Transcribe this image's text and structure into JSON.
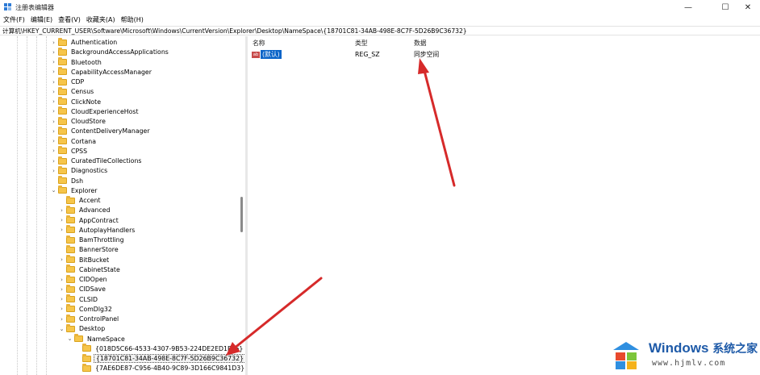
{
  "window": {
    "title": "注册表编辑器",
    "controls": {
      "minimize": "—",
      "maximize": "☐",
      "close": "✕"
    }
  },
  "menu": [
    "文件(F)",
    "编辑(E)",
    "查看(V)",
    "收藏夹(A)",
    "帮助(H)"
  ],
  "address": "计算机\\HKEY_CURRENT_USER\\Software\\Microsoft\\Windows\\CurrentVersion\\Explorer\\Desktop\\NameSpace\\{18701C81-34AB-498E-8C7F-5D26B9C36732}",
  "tree": {
    "level1": [
      {
        "label": "Authentication",
        "expander": "collapsed"
      },
      {
        "label": "BackgroundAccessApplications",
        "expander": "collapsed"
      },
      {
        "label": "Bluetooth",
        "expander": "collapsed"
      },
      {
        "label": "CapabilityAccessManager",
        "expander": "collapsed"
      },
      {
        "label": "CDP",
        "expander": "collapsed"
      },
      {
        "label": "Census",
        "expander": "collapsed"
      },
      {
        "label": "ClickNote",
        "expander": "collapsed"
      },
      {
        "label": "CloudExperienceHost",
        "expander": "collapsed"
      },
      {
        "label": "CloudStore",
        "expander": "collapsed"
      },
      {
        "label": "ContentDeliveryManager",
        "expander": "collapsed"
      },
      {
        "label": "Cortana",
        "expander": "collapsed"
      },
      {
        "label": "CPSS",
        "expander": "collapsed"
      },
      {
        "label": "CuratedTileCollections",
        "expander": "collapsed"
      },
      {
        "label": "Diagnostics",
        "expander": "collapsed"
      },
      {
        "label": "Dsh",
        "expander": "none"
      },
      {
        "label": "Explorer",
        "expander": "expanded"
      }
    ],
    "level2": [
      {
        "label": "Accent",
        "expander": "none"
      },
      {
        "label": "Advanced",
        "expander": "collapsed"
      },
      {
        "label": "AppContract",
        "expander": "collapsed"
      },
      {
        "label": "AutoplayHandlers",
        "expander": "collapsed"
      },
      {
        "label": "BamThrottling",
        "expander": "none"
      },
      {
        "label": "BannerStore",
        "expander": "none"
      },
      {
        "label": "BitBucket",
        "expander": "collapsed"
      },
      {
        "label": "CabinetState",
        "expander": "none"
      },
      {
        "label": "CIDOpen",
        "expander": "collapsed"
      },
      {
        "label": "CIDSave",
        "expander": "collapsed"
      },
      {
        "label": "CLSID",
        "expander": "collapsed"
      },
      {
        "label": "ComDlg32",
        "expander": "collapsed"
      },
      {
        "label": "ControlPanel",
        "expander": "collapsed"
      },
      {
        "label": "Desktop",
        "expander": "expanded"
      }
    ],
    "level3": [
      {
        "label": "NameSpace",
        "expander": "expanded"
      }
    ],
    "level4": [
      {
        "label": "{018D5C66-4533-4307-9B53-224DE2ED1FE6}",
        "selected": false
      },
      {
        "label": "{18701C81-34AB-498E-8C7F-5D26B9C36732}",
        "selected": true
      },
      {
        "label": "{7AE6DE87-C956-4B40-9C89-3D166C9841D3}",
        "selected": false
      }
    ],
    "chevrons": {
      "collapsed": "›",
      "expanded": "⌄"
    }
  },
  "list": {
    "headers": {
      "name": "名称",
      "type": "类型",
      "data": "数据"
    },
    "rows": [
      {
        "icon": "ab",
        "name": "(默认)",
        "type": "REG_SZ",
        "data": "同步空间"
      }
    ]
  },
  "colors": {
    "selection": "#0a64c8",
    "arrow": "#d62a2a",
    "folder": "#f6c54a",
    "watermark": "#1e5aa8"
  },
  "watermark": {
    "brand": "Windows",
    "cn": "系统之家",
    "url": "www.hjmlv.com"
  }
}
